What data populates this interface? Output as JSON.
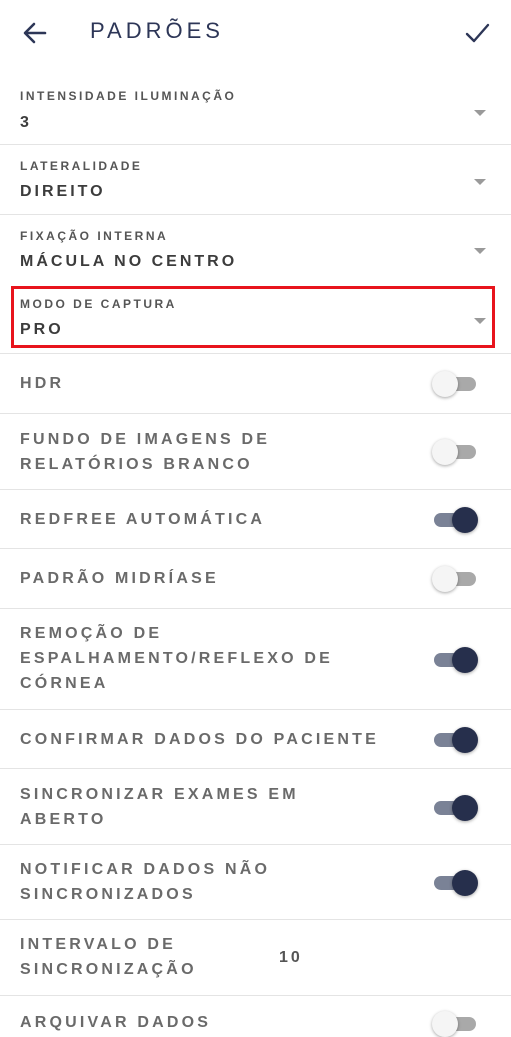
{
  "header": {
    "title": "PADRÕES",
    "back_icon": "arrow-left-icon",
    "confirm_icon": "check-icon"
  },
  "selects": [
    {
      "label": "INTENSIDADE ILUMINAÇÃO",
      "value": "3"
    },
    {
      "label": "LATERALIDADE",
      "value": "DIREITO"
    },
    {
      "label": "FIXAÇÃO INTERNA",
      "value": "MÁCULA NO CENTRO"
    },
    {
      "label": "MODO DE CAPTURA",
      "value": "PRO"
    }
  ],
  "settings": [
    {
      "label": "HDR",
      "on": false
    },
    {
      "label": "FUNDO DE IMAGENS DE RELATÓRIOS BRANCO",
      "on": false
    },
    {
      "label": "REDFREE AUTOMÁTICA",
      "on": true
    },
    {
      "label": "PADRÃO MIDRÍASE",
      "on": false
    },
    {
      "label": "REMOÇÃO DE ESPALHAMENTO/REFLEXO DE CÓRNEA",
      "on": true
    },
    {
      "label": "CONFIRMAR DADOS DO PACIENTE",
      "on": true
    },
    {
      "label": "SINCRONIZAR EXAMES EM ABERTO",
      "on": true
    },
    {
      "label": "NOTIFICAR DADOS NÃO SINCRONIZADOS",
      "on": true
    }
  ],
  "interval": {
    "label": "INTERVALO DE SINCRONIZAÇÃO",
    "value": "10"
  },
  "partial": {
    "label": "ARQUIVAR DADOS",
    "on": false
  },
  "colors": {
    "accent": "#262f4c",
    "highlight": "#e8141c"
  }
}
